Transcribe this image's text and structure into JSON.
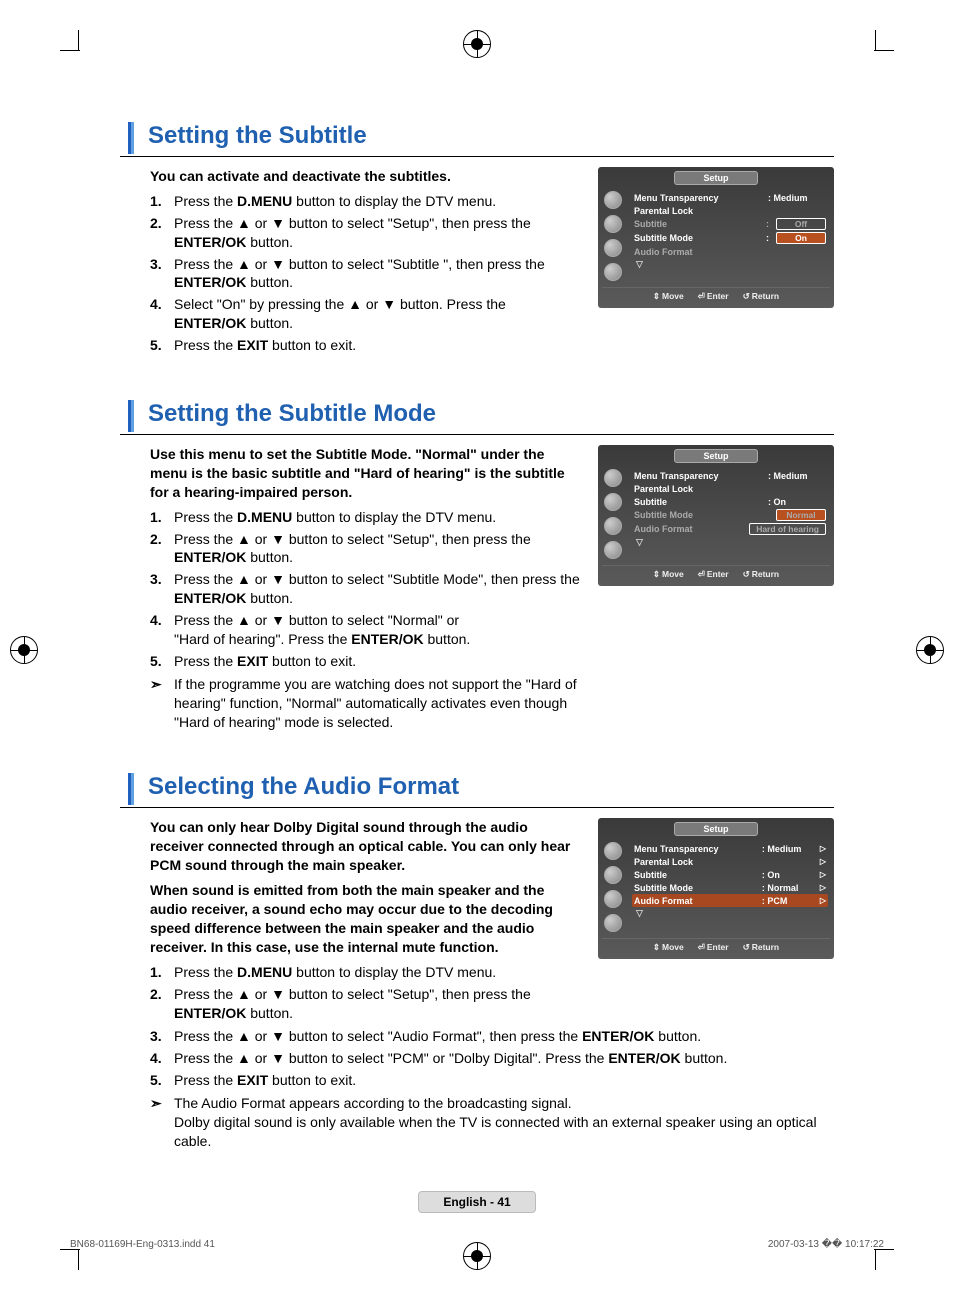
{
  "sections": [
    {
      "title": "Setting the Subtitle",
      "intro": "You can activate and deactivate the subtitles.",
      "steps": [
        {
          "n": "1.",
          "html": "Press the <b>D.MENU</b> button to display the DTV menu."
        },
        {
          "n": "2.",
          "html": "Press the ▲ or ▼ button to select \"Setup\", then press the <b>ENTER/OK</b> button."
        },
        {
          "n": "3.",
          "html": "Press the ▲ or ▼ button to select \"Subtitle \", then press the <b>ENTER/OK</b> button."
        },
        {
          "n": "4.",
          "html": "Select \"On\" by pressing the ▲ or ▼ button. Press the <b>ENTER/OK</b> button."
        },
        {
          "n": "5.",
          "html": "Press the <b>EXIT</b> button to exit."
        }
      ],
      "notes": [],
      "osd": {
        "title": "Setup",
        "rows": [
          {
            "label": "Menu Transparency",
            "val": ": Medium",
            "dim": false
          },
          {
            "label": "Parental Lock",
            "val": "",
            "dim": false
          },
          {
            "label": "Subtitle",
            "opts": [
              {
                "t": "Off",
                "sel": false
              }
            ],
            "colon": ":",
            "dim": true,
            "hl": false
          },
          {
            "label": "Subtitle  Mode",
            "opts": [
              {
                "t": "On",
                "sel": true
              }
            ],
            "colon": ":",
            "dim": false
          },
          {
            "label": "Audio Format",
            "val": "",
            "dim": true
          },
          {
            "down": true
          }
        ],
        "footer": [
          "Move",
          "Enter",
          "Return"
        ],
        "fsym": [
          "⇕",
          "⏎",
          "↺"
        ]
      }
    },
    {
      "title": "Setting the Subtitle Mode",
      "intro": "Use this menu to set the Subtitle Mode. \"Normal\" under the menu is the basic subtitle and \"Hard of hearing\" is the subtitle for a hearing-impaired person.",
      "steps": [
        {
          "n": "1.",
          "html": "Press the <b>D.MENU</b> button to display the DTV menu."
        },
        {
          "n": "2.",
          "html": "Press the ▲ or ▼ button to select \"Setup\", then press the <b>ENTER/OK</b> button."
        },
        {
          "n": "3.",
          "html": "Press the ▲ or ▼ button to select \"Subtitle  Mode\", then press the <b>ENTER/OK</b> button."
        },
        {
          "n": "4.",
          "html": "Press the ▲ or ▼ button to select \"Normal\" or<br>\"Hard of hearing\". Press the <b>ENTER/OK</b> button."
        },
        {
          "n": "5.",
          "html": "Press the <b>EXIT</b> button to exit."
        }
      ],
      "notes": [
        {
          "html": "If the programme you are watching does not support the \"Hard of hearing\" function, \"Normal\" automatically activates even though \"Hard of hearing\" mode is selected."
        }
      ],
      "osd": {
        "title": "Setup",
        "rows": [
          {
            "label": "Menu Transparency",
            "val": ": Medium",
            "dim": false
          },
          {
            "label": "Parental Lock",
            "val": "",
            "dim": false
          },
          {
            "label": "Subtitle",
            "val": ": On",
            "dim": false
          },
          {
            "label": "Subtitle  Mode",
            "opts": [
              {
                "t": "Normal",
                "sel": true
              }
            ],
            "dim": true
          },
          {
            "label": "Audio Format",
            "opts": [
              {
                "t": "Hard of hearing",
                "sel": false
              }
            ],
            "dim": true
          },
          {
            "down": true
          }
        ],
        "footer": [
          "Move",
          "Enter",
          "Return"
        ],
        "fsym": [
          "⇕",
          "⏎",
          "↺"
        ]
      }
    },
    {
      "title": "Selecting the Audio Format",
      "intro": "You can only hear Dolby Digital sound through the audio receiver connected through an optical cable. You can only hear PCM sound through the main speaker.\nWhen sound is emitted from both the main speaker and the audio receiver, a sound echo may occur due to the decoding speed difference between the main speaker and the audio receiver. In this case, use the internal mute function.",
      "steps": [
        {
          "n": "1.",
          "html": "Press the <b>D.MENU</b> button to display the DTV menu."
        },
        {
          "n": "2.",
          "html": "Press the ▲ or ▼ button to select \"Setup\", then press the <b>ENTER/OK</b> button."
        },
        {
          "n": "3.",
          "html": "Press the ▲ or ▼ button to select \"Audio Format\", then press the <b>ENTER/OK</b> button.",
          "full": true
        },
        {
          "n": "4.",
          "html": "Press the ▲ or ▼ button to select \"PCM\" or \"Dolby Digital\". Press the <b>ENTER/OK</b> button.",
          "full": true
        },
        {
          "n": "5.",
          "html": "Press the <b>EXIT</b> button to exit.",
          "full": true
        }
      ],
      "notes": [
        {
          "html": "The Audio Format appears according to the broadcasting signal.<br>Dolby digital sound is only available when the TV is connected with an external speaker using an optical cable.",
          "full": true
        }
      ],
      "osd": {
        "title": "Setup",
        "rows": [
          {
            "label": "Menu Transparency",
            "val": ": Medium",
            "tri": true
          },
          {
            "label": "Parental Lock",
            "val": "",
            "tri": true
          },
          {
            "label": "Subtitle",
            "val": ": On",
            "tri": true
          },
          {
            "label": "Subtitle  Mode",
            "val": ": Normal",
            "tri": true
          },
          {
            "label": "Audio Format",
            "val": ": PCM",
            "tri": true,
            "hl": true
          },
          {
            "down": true
          }
        ],
        "footer": [
          "Move",
          "Enter",
          "Return"
        ],
        "fsym": [
          "⇕",
          "⏎",
          "↺"
        ]
      }
    }
  ],
  "page_badge": "English - 41",
  "footer_left": "BN68-01169H-Eng-0313.indd   41",
  "footer_right": "2007-03-13   �� 10:17:22"
}
